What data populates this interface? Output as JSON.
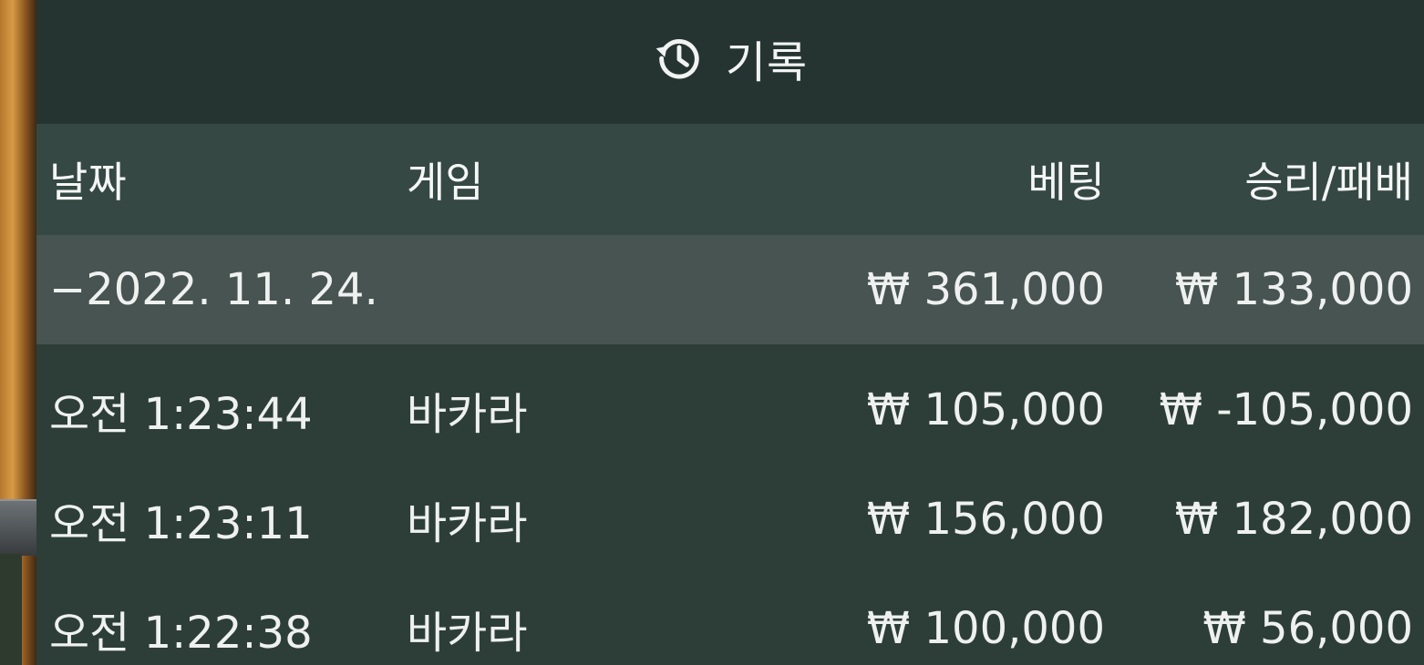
{
  "header": {
    "icon": "history-icon",
    "title": "기록"
  },
  "columns": {
    "date": "날짜",
    "game": "게임",
    "bet": "베팅",
    "win_loss": "승리/패배"
  },
  "date_group": {
    "date": "−2022. 11. 24.",
    "bet_total": "₩ 361,000",
    "win_loss_total": "₩ 133,000"
  },
  "rows": [
    {
      "time": "오전 1:23:44",
      "game": "바카라",
      "bet": "₩ 105,000",
      "win_loss": "₩ -105,000"
    },
    {
      "time": "오전 1:23:11",
      "game": "바카라",
      "bet": "₩ 156,000",
      "win_loss": "₩ 182,000"
    },
    {
      "time": "오전 1:22:38",
      "game": "바카라",
      "bet": "₩ 100,000",
      "win_loss": "₩ 56,000"
    }
  ],
  "colors": {
    "panel_bg": "#2d3e38",
    "header_bg": "#253430",
    "column_header_bg": "#354843",
    "date_row_bg": "#475451",
    "text": "#eef1ef"
  }
}
